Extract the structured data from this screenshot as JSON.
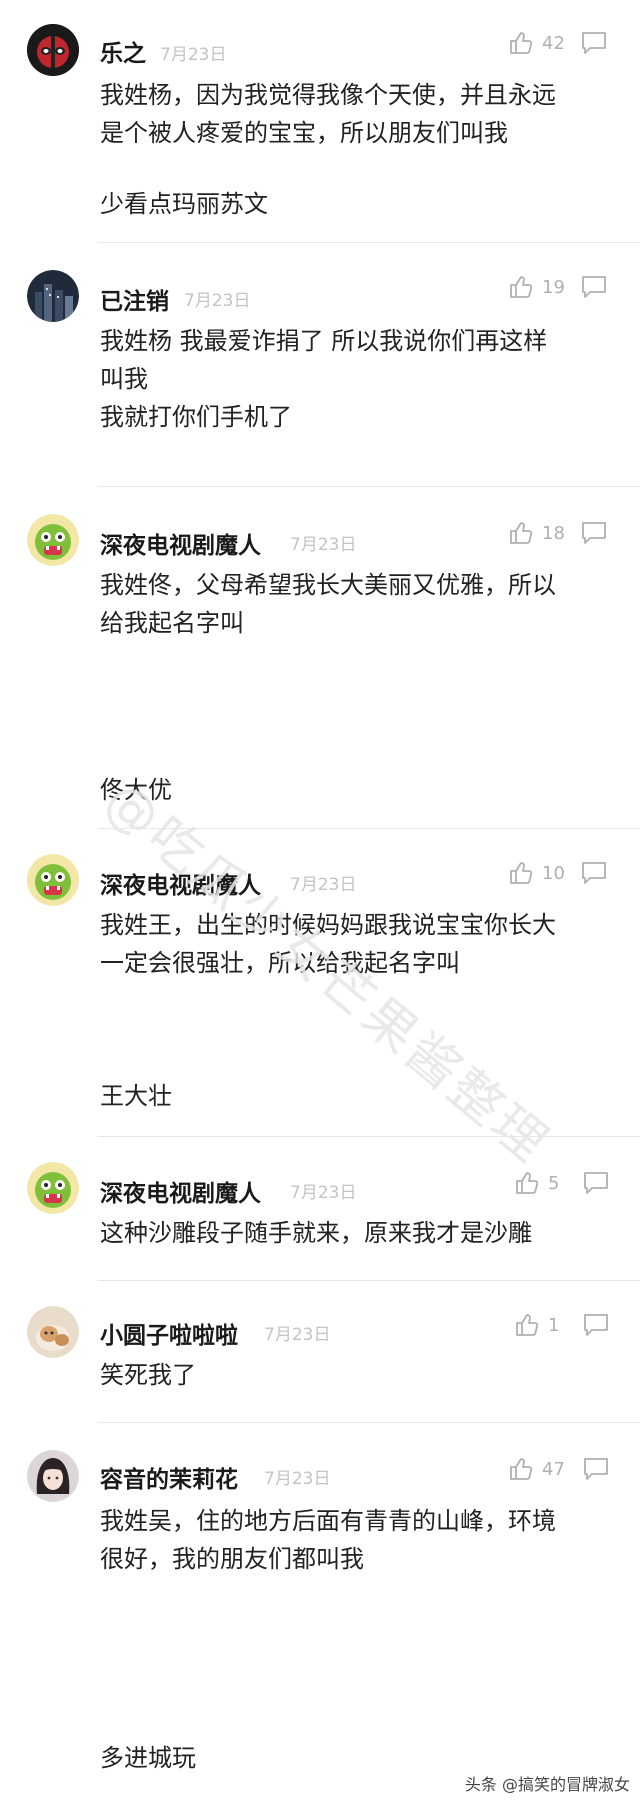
{
  "comments": [
    {
      "username": "乐之",
      "date": "7月23日",
      "likes": "42",
      "text": "我姓杨，因为我觉得我像个天使，并且永远\n是个被人疼爱的宝宝，所以朋友们叫我",
      "answer": "少看点玛丽苏文",
      "avatar_icon": "deadpool-avatar"
    },
    {
      "username": "已注销",
      "date": "7月23日",
      "likes": "19",
      "text": "我姓杨 我最爱诈捐了 所以我说你们再这样\n叫我\n我就打你们手机了",
      "answer": "",
      "avatar_icon": "city-night-avatar"
    },
    {
      "username": "深夜电视剧魔人",
      "date": "7月23日",
      "likes": "18",
      "text": "我姓佟，父母希望我长大美丽又优雅，所以\n给我起名字叫",
      "answer": "佟大优",
      "avatar_icon": "green-monster-avatar"
    },
    {
      "username": "深夜电视剧魔人",
      "date": "7月23日",
      "likes": "10",
      "text": "我姓王，出生的时候妈妈跟我说宝宝你长大\n一定会很强壮，所以给我起名字叫",
      "answer": "王大壮",
      "avatar_icon": "green-monster-avatar"
    },
    {
      "username": "深夜电视剧魔人",
      "date": "7月23日",
      "likes": "5",
      "text": "这种沙雕段子随手就来，原来我才是沙雕",
      "answer": "",
      "avatar_icon": "green-monster-avatar"
    },
    {
      "username": "小圆子啦啦啦",
      "date": "7月23日",
      "likes": "1",
      "text": "笑死我了",
      "answer": "",
      "avatar_icon": "cat-avatar"
    },
    {
      "username": "容音的茉莉花",
      "date": "7月23日",
      "likes": "47",
      "text": "我姓吴，住的地方后面有青青的山峰，环境\n很好，我的朋友们都叫我",
      "answer": "多进城玩",
      "avatar_icon": "girl-avatar"
    }
  ],
  "watermark": "@吃瓜少女芒果酱整理",
  "footer": "头条 @搞笑的冒牌淑女",
  "colors": {
    "meta": "#c4c4c4",
    "icon": "#b0b0b0",
    "divider": "#e8e8e8"
  }
}
